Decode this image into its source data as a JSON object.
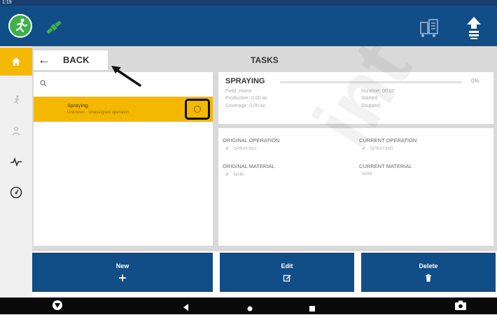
{
  "status_bar": {
    "time": "1:19"
  },
  "header": {
    "app_icon": "running-person-icon",
    "gps_icon": "satellite-icon",
    "machine_icon": "machine-icon",
    "upload_icon": "upload-icon"
  },
  "sidebar": {
    "items": [
      {
        "icon": "home-icon",
        "active": true
      },
      {
        "icon": "running-person-icon",
        "active": false
      },
      {
        "icon": "person-icon",
        "active": false
      },
      {
        "icon": "pulse-icon",
        "active": false
      },
      {
        "icon": "speedometer-icon",
        "active": false
      }
    ]
  },
  "nav": {
    "back_label": "BACK",
    "title": "TASKS"
  },
  "task_list": {
    "items": [
      {
        "name": "Spraying",
        "subtitle": "Unknown · Unassigned operation",
        "selected": true
      }
    ]
  },
  "task_detail": {
    "title": "SPRAYING",
    "progress_percent": "0%",
    "progress_value": 0,
    "field": "Field: Home",
    "productive": "Productive: 0.00 ac",
    "coverage": "Coverage: 0.00 ac",
    "runtime": "Runtime: 00:00",
    "started": "Started:",
    "stopped": "Stopped:"
  },
  "operation": {
    "original_operation_label": "ORIGINAL OPERATION",
    "original_operation_value": "SPRAYING",
    "current_operation_label": "CURRENT OPERATION",
    "current_operation_value": "SPRAYING",
    "original_material_label": "ORIGINAL MATERIAL",
    "original_material_value": "NAM",
    "current_material_label": "CURRENT MATERIAL",
    "current_material_value": "NAM"
  },
  "actions": {
    "new_label": "New",
    "edit_label": "Edit",
    "delete_label": "Delete"
  },
  "colors": {
    "primary": "#114d86",
    "accent": "#f5b800",
    "app_green": "#3db04a"
  }
}
